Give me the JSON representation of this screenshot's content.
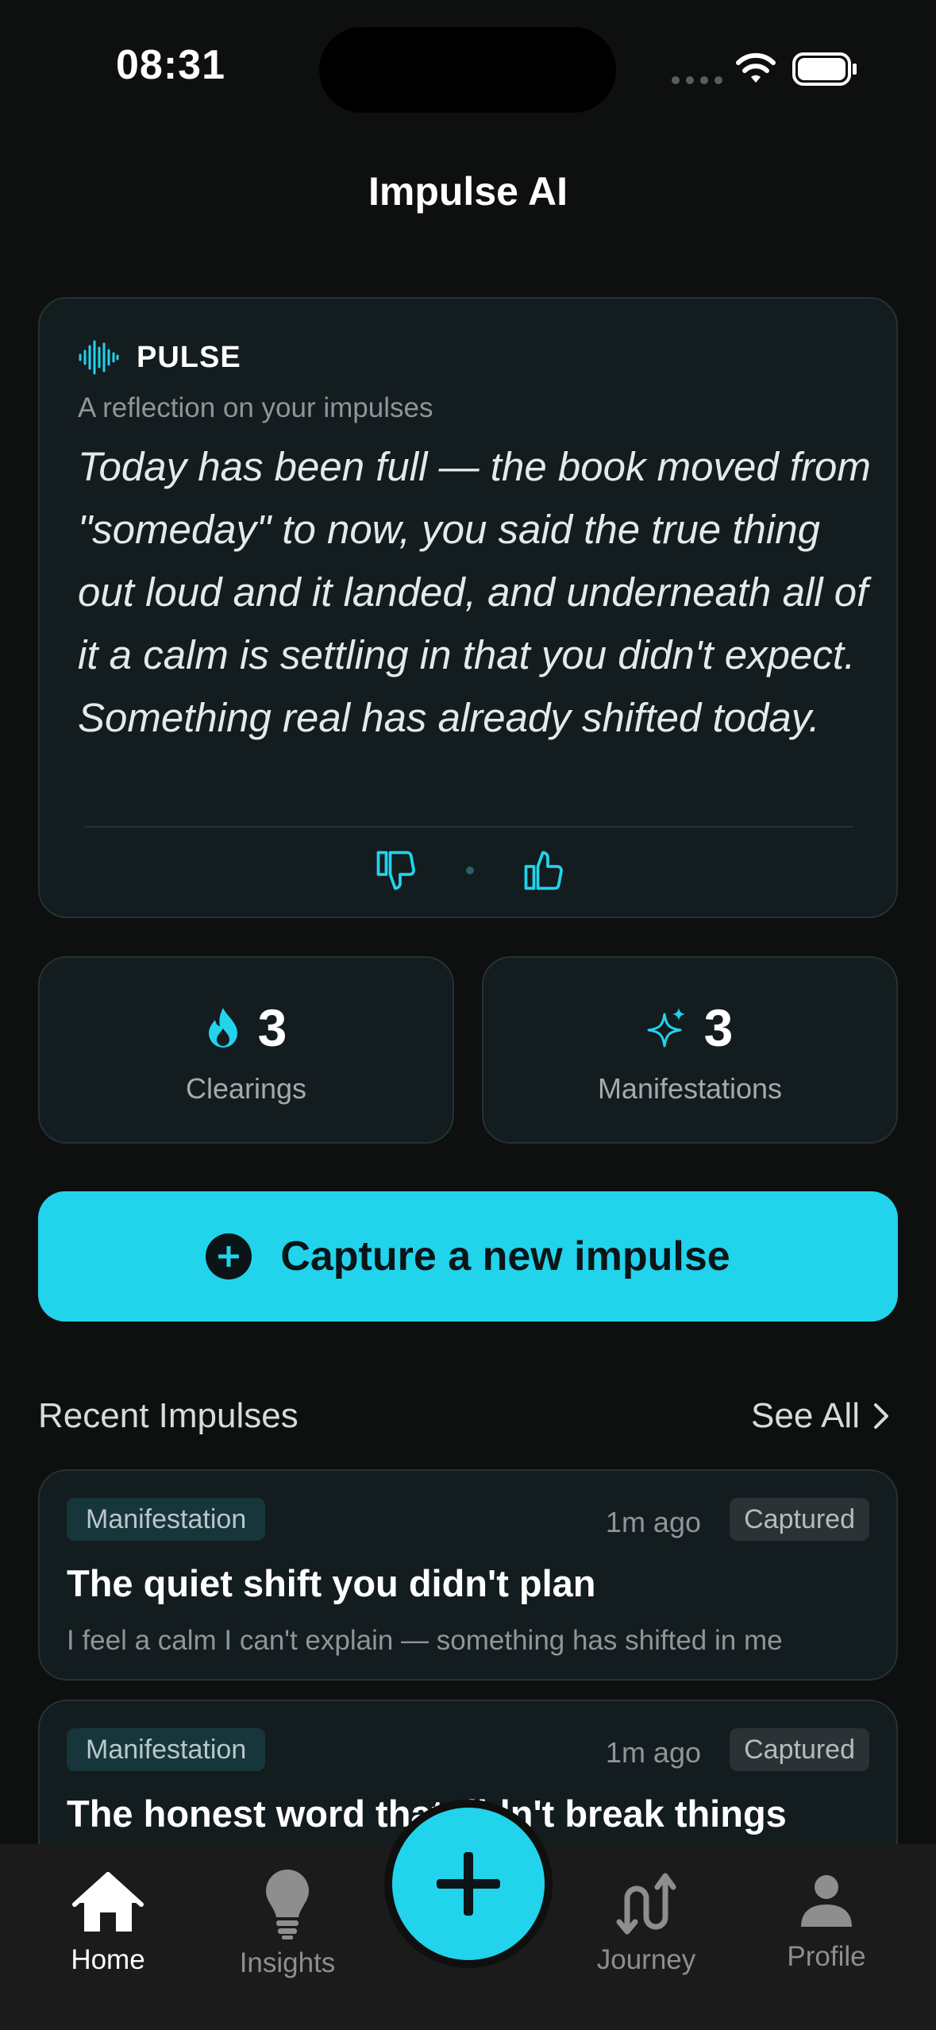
{
  "status_bar": {
    "time": "08:31"
  },
  "header": {
    "title": "Impulse AI"
  },
  "pulse": {
    "label": "PULSE",
    "subtitle": "A reflection on your impulses",
    "text": "Today has been full — the book moved from \"someday\" to now, you said the true thing out loud and it landed, and underneath all of it a calm is settling in that you didn't expect. Something real has already shifted today."
  },
  "stats": [
    {
      "icon": "flame-icon",
      "value": "3",
      "label": "Clearings"
    },
    {
      "icon": "sparkles-icon",
      "value": "3",
      "label": "Manifestations"
    }
  ],
  "capture_button": {
    "label": "Capture a new impulse"
  },
  "recent": {
    "title": "Recent Impulses",
    "see_all": "See All",
    "items": [
      {
        "tag": "Manifestation",
        "time": "1m ago",
        "status": "Captured",
        "title": "The quiet shift you didn't plan",
        "body": "I feel a calm I can't explain — something has shifted in me"
      },
      {
        "tag": "Manifestation",
        "time": "1m ago",
        "status": "Captured",
        "title": "The honest word that didn't break things",
        "body": ""
      }
    ]
  },
  "tabs": [
    {
      "label": "Home",
      "icon": "home-icon",
      "active": true
    },
    {
      "label": "Insights",
      "icon": "lightbulb-icon",
      "active": false
    },
    {
      "label": "Journey",
      "icon": "journey-icon",
      "active": false
    },
    {
      "label": "Profile",
      "icon": "person-icon",
      "active": false
    }
  ],
  "colors": {
    "accent": "#22d3ec",
    "background": "#0e0f0f",
    "card": "#131c1e"
  }
}
